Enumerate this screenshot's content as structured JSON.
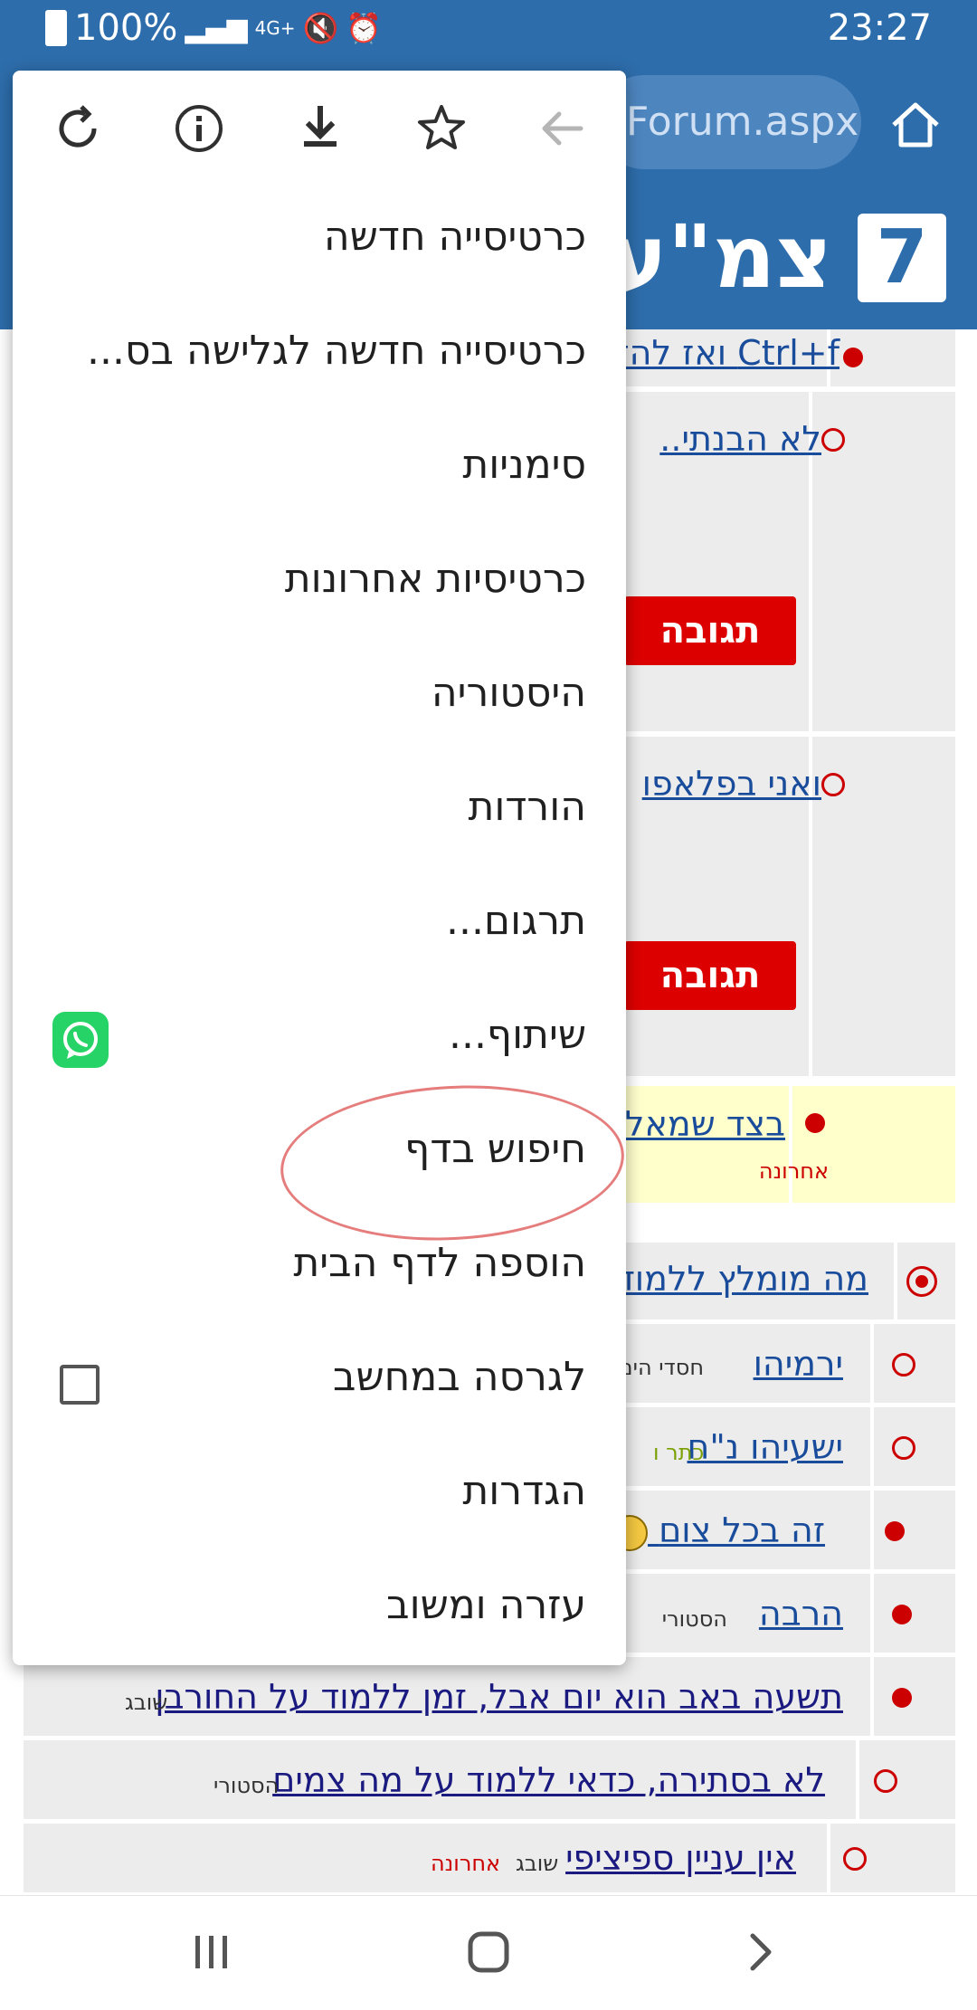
{
  "status_bar": {
    "battery": "100%",
    "time": "23:27",
    "network": "4G+"
  },
  "browser": {
    "url_text": "Forum.aspx"
  },
  "site_header": {
    "logo_number": "7",
    "title": "צמ\"ע"
  },
  "toolbar": {
    "icons": [
      "back-arrow-icon",
      "star-icon",
      "download-icon",
      "info-icon",
      "reload-icon"
    ]
  },
  "menu": {
    "items": [
      {
        "label": "כרטיסייה חדשה"
      },
      {
        "label": "כרטיסייה חדשה לגלישה בס..."
      },
      {
        "label": "סימניות"
      },
      {
        "label": "כרטיסיות אחרונות"
      },
      {
        "label": "היסטוריה"
      },
      {
        "label": "הורדות"
      },
      {
        "label": "תרגום..."
      },
      {
        "label": "שיתוף..."
      },
      {
        "label": "חיפוש בדף"
      },
      {
        "label": "הוספה לדף הבית"
      },
      {
        "label": "לגרסה במחשב",
        "checked": false
      },
      {
        "label": "הגדרות"
      },
      {
        "label": "עזרה ומשוב"
      }
    ]
  },
  "forum": {
    "reply_label": "תגובה",
    "rows": [
      {
        "title": "Ctrl+f ואז להז"
      },
      {
        "title": "לא הבנתי.."
      },
      {
        "title": "ואני בפלאפו"
      },
      {
        "title": "בצד שמאל",
        "meta": "אחרונה"
      },
      {
        "title": "מה מומלץ ללמוד ו"
      },
      {
        "title": "ירמיהו",
        "meta": "חסדי הים"
      },
      {
        "title": "ישעיהו נ\"ח",
        "meta": "כתר ו"
      },
      {
        "title": "זה בכל צום"
      },
      {
        "title": "הרבה",
        "meta": "הסטורי"
      },
      {
        "title": "תשעה באב הוא יום אבל, זמן ללמוד על החורבן",
        "meta": "שובג"
      },
      {
        "title": "לא בסתירה, כדאי ללמוד על מה צמים",
        "meta": "הסטורי"
      },
      {
        "title": "אין עניין ספיציפי",
        "meta": "שובג",
        "meta2": "אחרונה"
      }
    ]
  },
  "colors": {
    "header_blue": "#2d6dab",
    "accent_red": "#dd0000",
    "whatsapp_green": "#25d366"
  }
}
